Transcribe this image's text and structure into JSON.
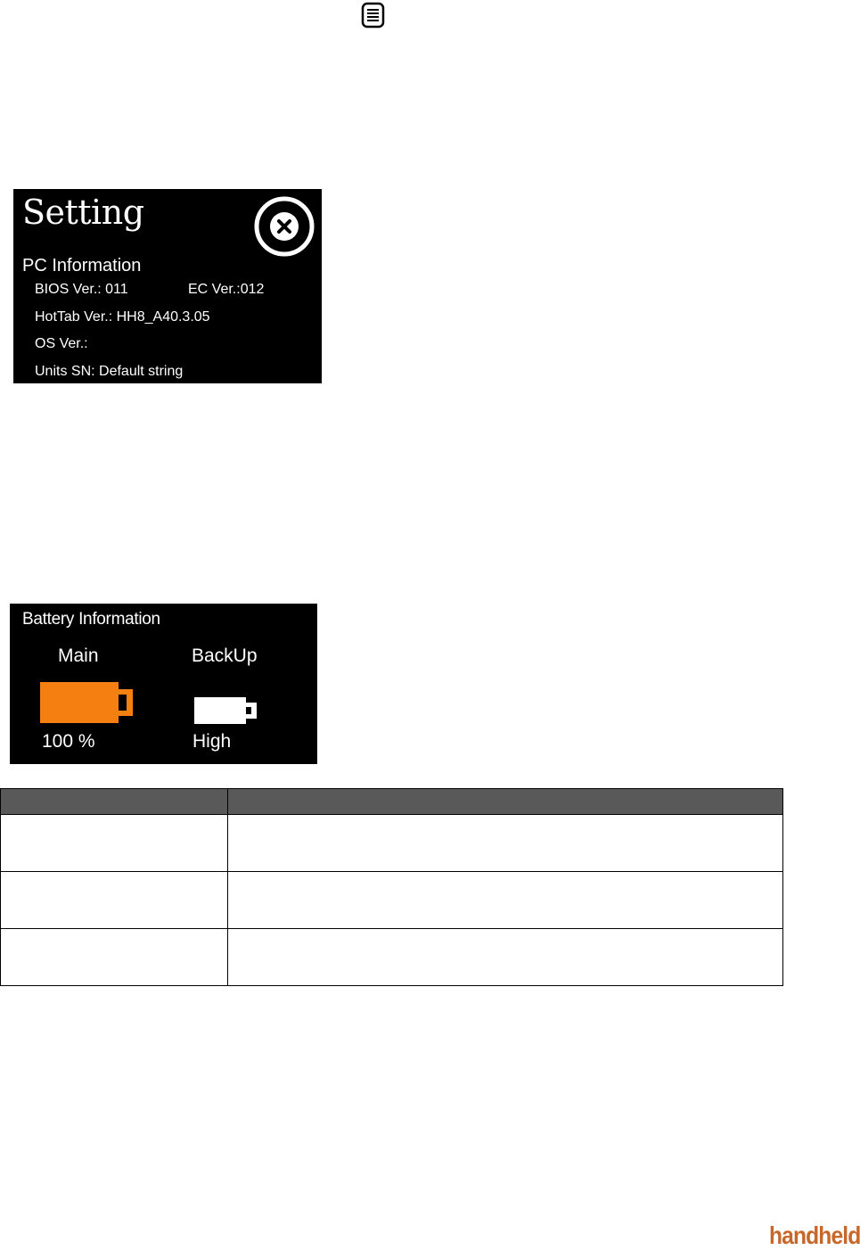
{
  "setting": {
    "title": "Setting",
    "pc_heading": "PC Information",
    "bios": "BIOS Ver.: 011",
    "ec": "EC Ver.:012",
    "hottab": "HotTab Ver.: HH8_A40.3.05",
    "os": "OS Ver.:",
    "sn": "Units SN: Default string"
  },
  "battery": {
    "heading": "Battery Information",
    "main_label": "Main",
    "backup_label": "BackUp",
    "main_value": "100 %",
    "backup_value": "High",
    "main_level": 1.0,
    "main_color": "#f57f10",
    "backup_color": "#ffffff"
  },
  "table": {
    "header_color": "#595959",
    "rows": 3
  },
  "logo": {
    "text": "handheld",
    "color": "#c8672a"
  }
}
